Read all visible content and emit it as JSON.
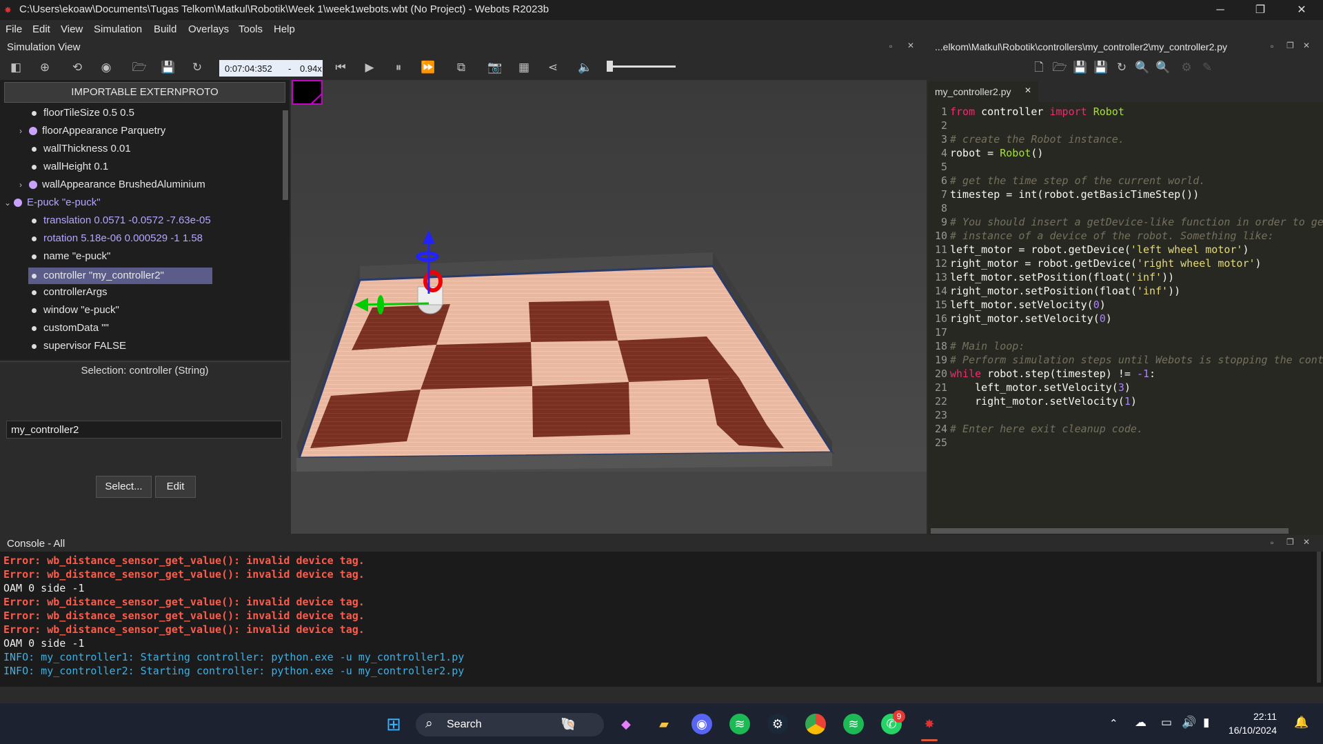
{
  "window": {
    "title": "C:\\Users\\ekoaw\\Documents\\Tugas Telkom\\Matkul\\Robotik\\Week 1\\week1webots.wbt (No Project) - Webots R2023b"
  },
  "menu": [
    "File",
    "Edit",
    "View",
    "Simulation",
    "Build",
    "Overlays",
    "Tools",
    "Help"
  ],
  "simulation_view": {
    "title": "Simulation View",
    "time": "0:07:04:352",
    "speed_sep": "-",
    "speed": "0.94x"
  },
  "scene_tree": {
    "proto_button": "IMPORTABLE EXTERNPROTO",
    "rows": [
      {
        "label": "floorTileSize 0.5 0.5"
      },
      {
        "label": "floorAppearance Parquetry"
      },
      {
        "label": "wallThickness 0.01"
      },
      {
        "label": "wallHeight 0.1"
      },
      {
        "label": "wallAppearance BrushedAluminium"
      },
      {
        "label": "E-puck \"e-puck\""
      },
      {
        "label": "translation 0.0571 -0.0572 -7.63e-05"
      },
      {
        "label": "rotation 5.18e-06 0.000529 -1 1.58"
      },
      {
        "label": "name \"e-puck\""
      },
      {
        "label": "controller \"my_controller2\""
      },
      {
        "label": "controllerArgs"
      },
      {
        "label": "window \"e-puck\""
      },
      {
        "label": "customData \"\""
      },
      {
        "label": "supervisor FALSE"
      }
    ]
  },
  "field_editor": {
    "selection": "Selection: controller (String)",
    "value": "my_controller2",
    "select_button": "Select...",
    "edit_button": "Edit"
  },
  "editor": {
    "path": "...elkom\\Matkul\\Robotik\\controllers\\my_controller2\\my_controller2.py",
    "tab": "my_controller2.py",
    "line_numbers": [
      "1",
      "2",
      "3",
      "4",
      "5",
      "6",
      "7",
      "8",
      "9",
      "10",
      "11",
      "12",
      "13",
      "14",
      "15",
      "16",
      "17",
      "18",
      "19",
      "20",
      "21",
      "22",
      "23",
      "24",
      "25"
    ],
    "code": {
      "l1_from": "from",
      "l1_mod": " controller ",
      "l1_import": "import",
      "l1_cls": " Robot",
      "l3": "# create the Robot instance.",
      "l4_a": "robot = ",
      "l4_b": "Robot",
      "l4_c": "()",
      "l6": "# get the time step of the current world.",
      "l7": "timestep = int(robot.getBasicTimeStep())",
      "l9": "# You should insert a getDevice-like function in order to get the",
      "l10": "# instance of a device of the robot. Something like:",
      "l11_a": "left_motor = robot.getDevice(",
      "l11_s": "'left wheel motor'",
      "l11_c": ")",
      "l12_a": "right_motor = robot.getDevice(",
      "l12_s": "'right wheel motor'",
      "l12_c": ")",
      "l13_a": "left_motor.setPosition(float(",
      "l13_s": "'inf'",
      "l13_c": "))",
      "l14_a": "right_motor.setPosition(float(",
      "l14_s": "'inf'",
      "l14_c": "))",
      "l15_a": "left_motor.setVelocity(",
      "l15_n": "0",
      "l15_c": ")",
      "l16_a": "right_motor.setVelocity(",
      "l16_n": "0",
      "l16_c": ")",
      "l18": "# Main loop:",
      "l19": "# Perform simulation steps until Webots is stopping the controller",
      "l20_kw": "while",
      "l20_a": " robot.step(timestep) != ",
      "l20_n": "-1",
      "l20_c": ":",
      "l21_a": "    left_motor.setVelocity(",
      "l21_n": "3",
      "l21_c": ")",
      "l22_a": "    right_motor.setVelocity(",
      "l22_n": "1",
      "l22_c": ")",
      "l24": "# Enter here exit cleanup code."
    }
  },
  "console": {
    "title": "Console - All",
    "lines": [
      {
        "kind": "err",
        "text": "Error: wb_distance_sensor_get_value(): invalid device tag."
      },
      {
        "kind": "err",
        "text": "Error: wb_distance_sensor_get_value(): invalid device tag."
      },
      {
        "kind": "norm",
        "text": "OAM 0 side -1"
      },
      {
        "kind": "err",
        "text": "Error: wb_distance_sensor_get_value(): invalid device tag."
      },
      {
        "kind": "err",
        "text": "Error: wb_distance_sensor_get_value(): invalid device tag."
      },
      {
        "kind": "err",
        "text": "Error: wb_distance_sensor_get_value(): invalid device tag."
      },
      {
        "kind": "norm",
        "text": "OAM 0 side -1"
      },
      {
        "kind": "info",
        "text": "INFO: my_controller1: Starting controller: python.exe -u my_controller1.py"
      },
      {
        "kind": "info",
        "text": "INFO: my_controller2: Starting controller: python.exe -u my_controller2.py"
      }
    ]
  },
  "taskbar": {
    "search": "Search",
    "time": "22:11",
    "date": "16/10/2024",
    "whatsapp_badge": "9",
    "apps": [
      "windows-start-icon",
      "copilot-icon",
      "file-explorer-icon",
      "discord-icon",
      "spotify-icon",
      "steam-icon",
      "chrome-icon",
      "spotify-icon",
      "whatsapp-icon",
      "webots-icon"
    ]
  },
  "colors": {
    "editor_bg": "#272822",
    "error": "#ff5b4a",
    "info": "#3cb1e8",
    "selected_row": "#5c5c8a"
  }
}
